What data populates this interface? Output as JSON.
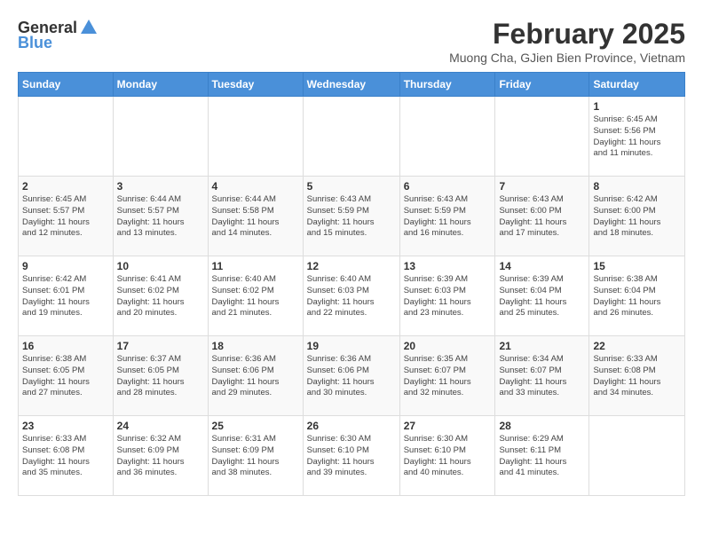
{
  "header": {
    "logo_general": "General",
    "logo_blue": "Blue",
    "title": "February 2025",
    "subtitle": "Muong Cha, GJien Bien Province, Vietnam"
  },
  "weekdays": [
    "Sunday",
    "Monday",
    "Tuesday",
    "Wednesday",
    "Thursday",
    "Friday",
    "Saturday"
  ],
  "weeks": [
    [
      {
        "day": "",
        "info": ""
      },
      {
        "day": "",
        "info": ""
      },
      {
        "day": "",
        "info": ""
      },
      {
        "day": "",
        "info": ""
      },
      {
        "day": "",
        "info": ""
      },
      {
        "day": "",
        "info": ""
      },
      {
        "day": "1",
        "info": "Sunrise: 6:45 AM\nSunset: 5:56 PM\nDaylight: 11 hours\nand 11 minutes."
      }
    ],
    [
      {
        "day": "2",
        "info": "Sunrise: 6:45 AM\nSunset: 5:57 PM\nDaylight: 11 hours\nand 12 minutes."
      },
      {
        "day": "3",
        "info": "Sunrise: 6:44 AM\nSunset: 5:57 PM\nDaylight: 11 hours\nand 13 minutes."
      },
      {
        "day": "4",
        "info": "Sunrise: 6:44 AM\nSunset: 5:58 PM\nDaylight: 11 hours\nand 14 minutes."
      },
      {
        "day": "5",
        "info": "Sunrise: 6:43 AM\nSunset: 5:59 PM\nDaylight: 11 hours\nand 15 minutes."
      },
      {
        "day": "6",
        "info": "Sunrise: 6:43 AM\nSunset: 5:59 PM\nDaylight: 11 hours\nand 16 minutes."
      },
      {
        "day": "7",
        "info": "Sunrise: 6:43 AM\nSunset: 6:00 PM\nDaylight: 11 hours\nand 17 minutes."
      },
      {
        "day": "8",
        "info": "Sunrise: 6:42 AM\nSunset: 6:00 PM\nDaylight: 11 hours\nand 18 minutes."
      }
    ],
    [
      {
        "day": "9",
        "info": "Sunrise: 6:42 AM\nSunset: 6:01 PM\nDaylight: 11 hours\nand 19 minutes."
      },
      {
        "day": "10",
        "info": "Sunrise: 6:41 AM\nSunset: 6:02 PM\nDaylight: 11 hours\nand 20 minutes."
      },
      {
        "day": "11",
        "info": "Sunrise: 6:40 AM\nSunset: 6:02 PM\nDaylight: 11 hours\nand 21 minutes."
      },
      {
        "day": "12",
        "info": "Sunrise: 6:40 AM\nSunset: 6:03 PM\nDaylight: 11 hours\nand 22 minutes."
      },
      {
        "day": "13",
        "info": "Sunrise: 6:39 AM\nSunset: 6:03 PM\nDaylight: 11 hours\nand 23 minutes."
      },
      {
        "day": "14",
        "info": "Sunrise: 6:39 AM\nSunset: 6:04 PM\nDaylight: 11 hours\nand 25 minutes."
      },
      {
        "day": "15",
        "info": "Sunrise: 6:38 AM\nSunset: 6:04 PM\nDaylight: 11 hours\nand 26 minutes."
      }
    ],
    [
      {
        "day": "16",
        "info": "Sunrise: 6:38 AM\nSunset: 6:05 PM\nDaylight: 11 hours\nand 27 minutes."
      },
      {
        "day": "17",
        "info": "Sunrise: 6:37 AM\nSunset: 6:05 PM\nDaylight: 11 hours\nand 28 minutes."
      },
      {
        "day": "18",
        "info": "Sunrise: 6:36 AM\nSunset: 6:06 PM\nDaylight: 11 hours\nand 29 minutes."
      },
      {
        "day": "19",
        "info": "Sunrise: 6:36 AM\nSunset: 6:06 PM\nDaylight: 11 hours\nand 30 minutes."
      },
      {
        "day": "20",
        "info": "Sunrise: 6:35 AM\nSunset: 6:07 PM\nDaylight: 11 hours\nand 32 minutes."
      },
      {
        "day": "21",
        "info": "Sunrise: 6:34 AM\nSunset: 6:07 PM\nDaylight: 11 hours\nand 33 minutes."
      },
      {
        "day": "22",
        "info": "Sunrise: 6:33 AM\nSunset: 6:08 PM\nDaylight: 11 hours\nand 34 minutes."
      }
    ],
    [
      {
        "day": "23",
        "info": "Sunrise: 6:33 AM\nSunset: 6:08 PM\nDaylight: 11 hours\nand 35 minutes."
      },
      {
        "day": "24",
        "info": "Sunrise: 6:32 AM\nSunset: 6:09 PM\nDaylight: 11 hours\nand 36 minutes."
      },
      {
        "day": "25",
        "info": "Sunrise: 6:31 AM\nSunset: 6:09 PM\nDaylight: 11 hours\nand 38 minutes."
      },
      {
        "day": "26",
        "info": "Sunrise: 6:30 AM\nSunset: 6:10 PM\nDaylight: 11 hours\nand 39 minutes."
      },
      {
        "day": "27",
        "info": "Sunrise: 6:30 AM\nSunset: 6:10 PM\nDaylight: 11 hours\nand 40 minutes."
      },
      {
        "day": "28",
        "info": "Sunrise: 6:29 AM\nSunset: 6:11 PM\nDaylight: 11 hours\nand 41 minutes."
      },
      {
        "day": "",
        "info": ""
      }
    ]
  ]
}
